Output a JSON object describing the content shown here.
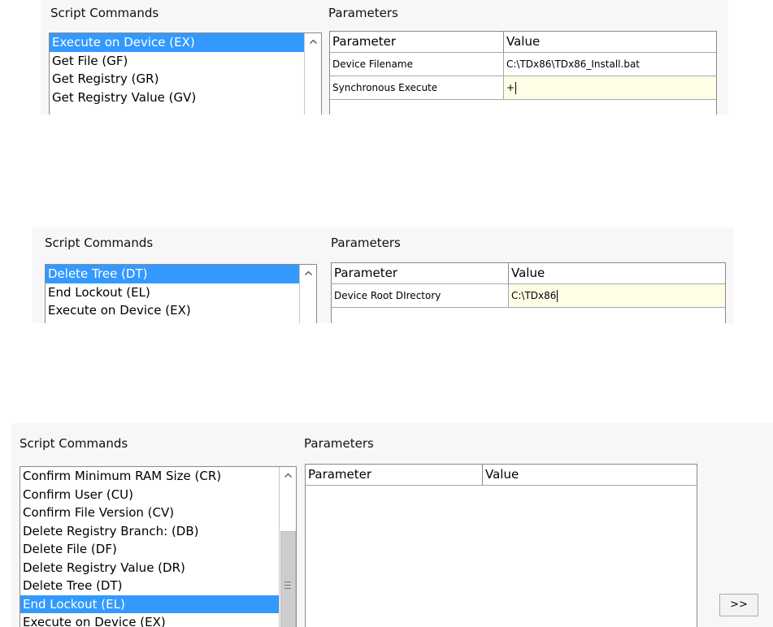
{
  "panels": [
    {
      "script_commands_heading": "Script Commands",
      "parameters_heading": "Parameters",
      "commands": [
        "Execute on Device (EX)",
        "Get File (GF)",
        "Get Registry (GR)",
        "Get Registry Value (GV)"
      ],
      "selected_command": "Execute on Device (EX)",
      "grid": {
        "header": {
          "parameter": "Parameter",
          "value": "Value"
        },
        "rows": [
          {
            "parameter": "Device Filename",
            "value": "C:\\TDx86\\TDx86_Install.bat"
          },
          {
            "parameter": "Synchronous Execute",
            "value": "+"
          }
        ]
      }
    },
    {
      "script_commands_heading": "Script Commands",
      "parameters_heading": "Parameters",
      "commands": [
        "Delete Tree (DT)",
        "End Lockout (EL)",
        "Execute on Device (EX)"
      ],
      "selected_command": "Delete Tree (DT)",
      "grid": {
        "header": {
          "parameter": "Parameter",
          "value": "Value"
        },
        "rows": [
          {
            "parameter": "Device Root DIrectory",
            "value": "C:\\TDx86"
          }
        ]
      }
    },
    {
      "script_commands_heading": "Script Commands",
      "parameters_heading": "Parameters",
      "commands": [
        "Confirm Minimum RAM Size (CR)",
        "Confirm User (CU)",
        "Confirm File Version (CV)",
        "Delete Registry Branch: (DB)",
        "Delete File (DF)",
        "Delete Registry Value (DR)",
        "Delete Tree (DT)",
        "End Lockout (EL)",
        "Execute on Device (EX)"
      ],
      "selected_command": "End Lockout (EL)",
      "grid": {
        "header": {
          "parameter": "Parameter",
          "value": "Value"
        },
        "rows": []
      },
      "move_button_label": ">>"
    }
  ],
  "icons": {
    "scroll_up": "chevron-up-icon",
    "scroll_grip": "grip-icon"
  },
  "colors": {
    "selection": "#3399ff",
    "panel_background": "#f8f6f9",
    "editing_cell": "#fefde6",
    "scrollbar_thumb": "#cdcdcd"
  }
}
